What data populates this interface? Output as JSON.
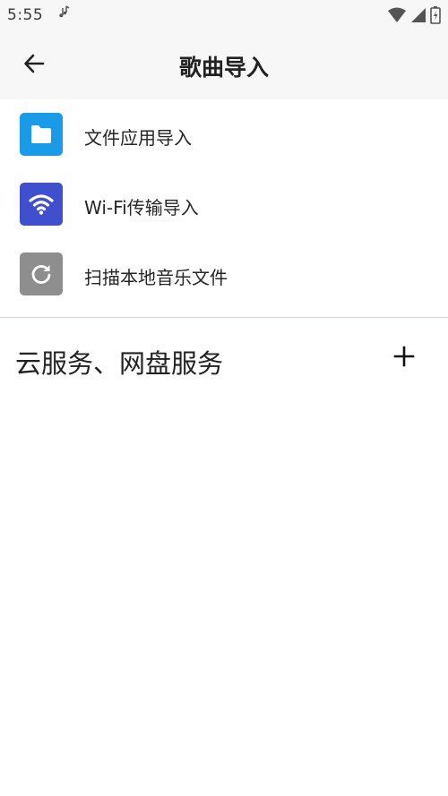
{
  "status_bar": {
    "time": "5:55",
    "icons": [
      "music-note-icon",
      "wifi-icon",
      "signal-icon",
      "battery-icon"
    ]
  },
  "app_bar": {
    "title": "歌曲导入",
    "back_icon": "arrow-left-icon"
  },
  "import_options": [
    {
      "label": "文件应用导入",
      "icon": "folder-icon",
      "color": "#1a9bea"
    },
    {
      "label": "Wi-Fi传输导入",
      "icon": "wifi-icon",
      "color": "#3f4fce"
    },
    {
      "label": "扫描本地音乐文件",
      "icon": "refresh-icon",
      "color": "#8e8e8e"
    }
  ],
  "cloud_section": {
    "title": "云服务、网盘服务",
    "add_icon": "plus-icon"
  },
  "colors": {
    "bar_background": "#f7f7f7",
    "divider": "#e2cfd6"
  }
}
